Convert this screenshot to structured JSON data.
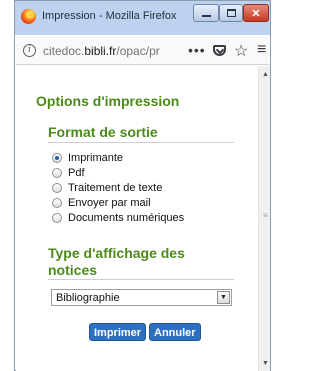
{
  "window": {
    "title": "Impression - Mozilla Firefox",
    "controls": {
      "minimize": "",
      "maximize": "",
      "close": "✕"
    }
  },
  "urlbar": {
    "url_prefix": "citedoc.",
    "url_domain": "bibli.fr",
    "url_path": "/opac/pr",
    "icons": [
      "info-icon",
      "more-actions-icon",
      "pocket-icon",
      "bookmark-star-icon",
      "menu-icon"
    ]
  },
  "page": {
    "heading": "Options d'impression",
    "output_section": {
      "title": "Format de sortie",
      "options": [
        {
          "label": "Imprimante",
          "checked": true
        },
        {
          "label": "Pdf",
          "checked": false
        },
        {
          "label": "Traitement de texte",
          "checked": false
        },
        {
          "label": "Envoyer par mail",
          "checked": false
        },
        {
          "label": "Documents numériques",
          "checked": false
        }
      ]
    },
    "display_section": {
      "title": "Type d'affichage des notices",
      "selected": "Bibliographie"
    },
    "buttons": {
      "print": "Imprimer",
      "cancel": "Annuler"
    }
  },
  "colors": {
    "heading_green": "#4c8a1a",
    "button_blue": "#2f6fbf",
    "titlebar": "#bcd2ee"
  }
}
